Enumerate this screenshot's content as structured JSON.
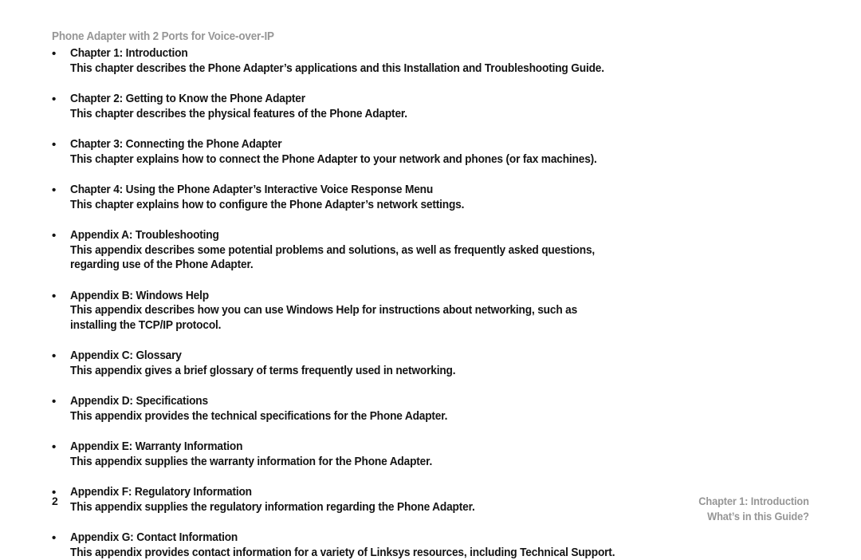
{
  "header": {
    "running_title": "Phone Adapter with 2 Ports for Voice-over-IP"
  },
  "colors": {
    "body_text": "#141414",
    "muted_text": "#969696",
    "page_background": "#ffffff"
  },
  "content": {
    "bullet_glyph": "•",
    "items": [
      {
        "title": "Chapter 1: Introduction",
        "description_lines": [
          "This chapter describes the Phone Adapter’s applications and this Installation and Troubleshooting Guide."
        ]
      },
      {
        "title": "Chapter 2: Getting to Know the Phone Adapter",
        "description_lines": [
          "This chapter describes the physical features of the Phone Adapter."
        ]
      },
      {
        "title": "Chapter 3: Connecting the Phone Adapter",
        "description_lines": [
          "This chapter explains how to connect the Phone Adapter to your network and phones (or fax machines)."
        ]
      },
      {
        "title": "Chapter 4: Using the Phone Adapter’s Interactive Voice Response Menu",
        "description_lines": [
          "This chapter explains how to configure the Phone Adapter’s network settings."
        ]
      },
      {
        "title": "Appendix A: Troubleshooting",
        "description_lines": [
          "This appendix describes some potential problems and solutions, as well as frequently asked questions,",
          "regarding use of the Phone Adapter."
        ]
      },
      {
        "title": "Appendix B: Windows Help",
        "description_lines": [
          "This appendix describes how you can use Windows Help for instructions about networking, such as",
          "installing the TCP/IP protocol."
        ]
      },
      {
        "title": "Appendix C: Glossary",
        "description_lines": [
          "This appendix gives a brief glossary of terms frequently used in networking."
        ]
      },
      {
        "title": "Appendix D: Specifications",
        "description_lines": [
          "This appendix provides the technical specifications for the Phone Adapter."
        ]
      },
      {
        "title": "Appendix E: Warranty Information",
        "description_lines": [
          "This appendix supplies the warranty information for the Phone Adapter."
        ]
      },
      {
        "title": "Appendix F: Regulatory Information",
        "description_lines": [
          "This appendix supplies the regulatory information regarding the Phone Adapter."
        ]
      },
      {
        "title": "Appendix G: Contact Information",
        "description_lines": [
          "This appendix provides contact information for a variety of Linksys resources, including Technical Support."
        ]
      }
    ]
  },
  "footer": {
    "page_number": "2",
    "chapter_reference": "Chapter 1: Introduction",
    "section_reference": "What’s in this Guide?"
  }
}
